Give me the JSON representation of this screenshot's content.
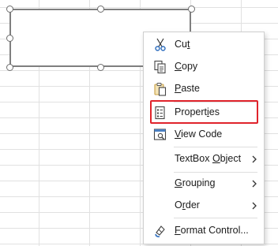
{
  "context_menu": {
    "items": [
      {
        "label": "Cut",
        "accel": "t",
        "icon": "scissors-icon"
      },
      {
        "label": "Copy",
        "accel": "C",
        "icon": "copy-icon"
      },
      {
        "label": "Paste",
        "accel": "P",
        "icon": "paste-icon"
      },
      {
        "label": "Properties",
        "accel": "i",
        "icon": "properties-icon",
        "highlighted": true
      },
      {
        "label": "View Code",
        "accel": "V",
        "icon": "view-code-icon"
      },
      {
        "label": "TextBox Object",
        "accel": "O",
        "submenu": true
      },
      {
        "label": "Grouping",
        "accel": "G",
        "submenu": true
      },
      {
        "label": "Order",
        "accel": "r",
        "submenu": true
      },
      {
        "label": "Format Control...",
        "accel": "F",
        "icon": "format-control-icon"
      }
    ]
  },
  "colors": {
    "highlight_border": "#e0232b",
    "cut_icon": "#2f6fbf",
    "paste_icon": "#c8a046"
  }
}
